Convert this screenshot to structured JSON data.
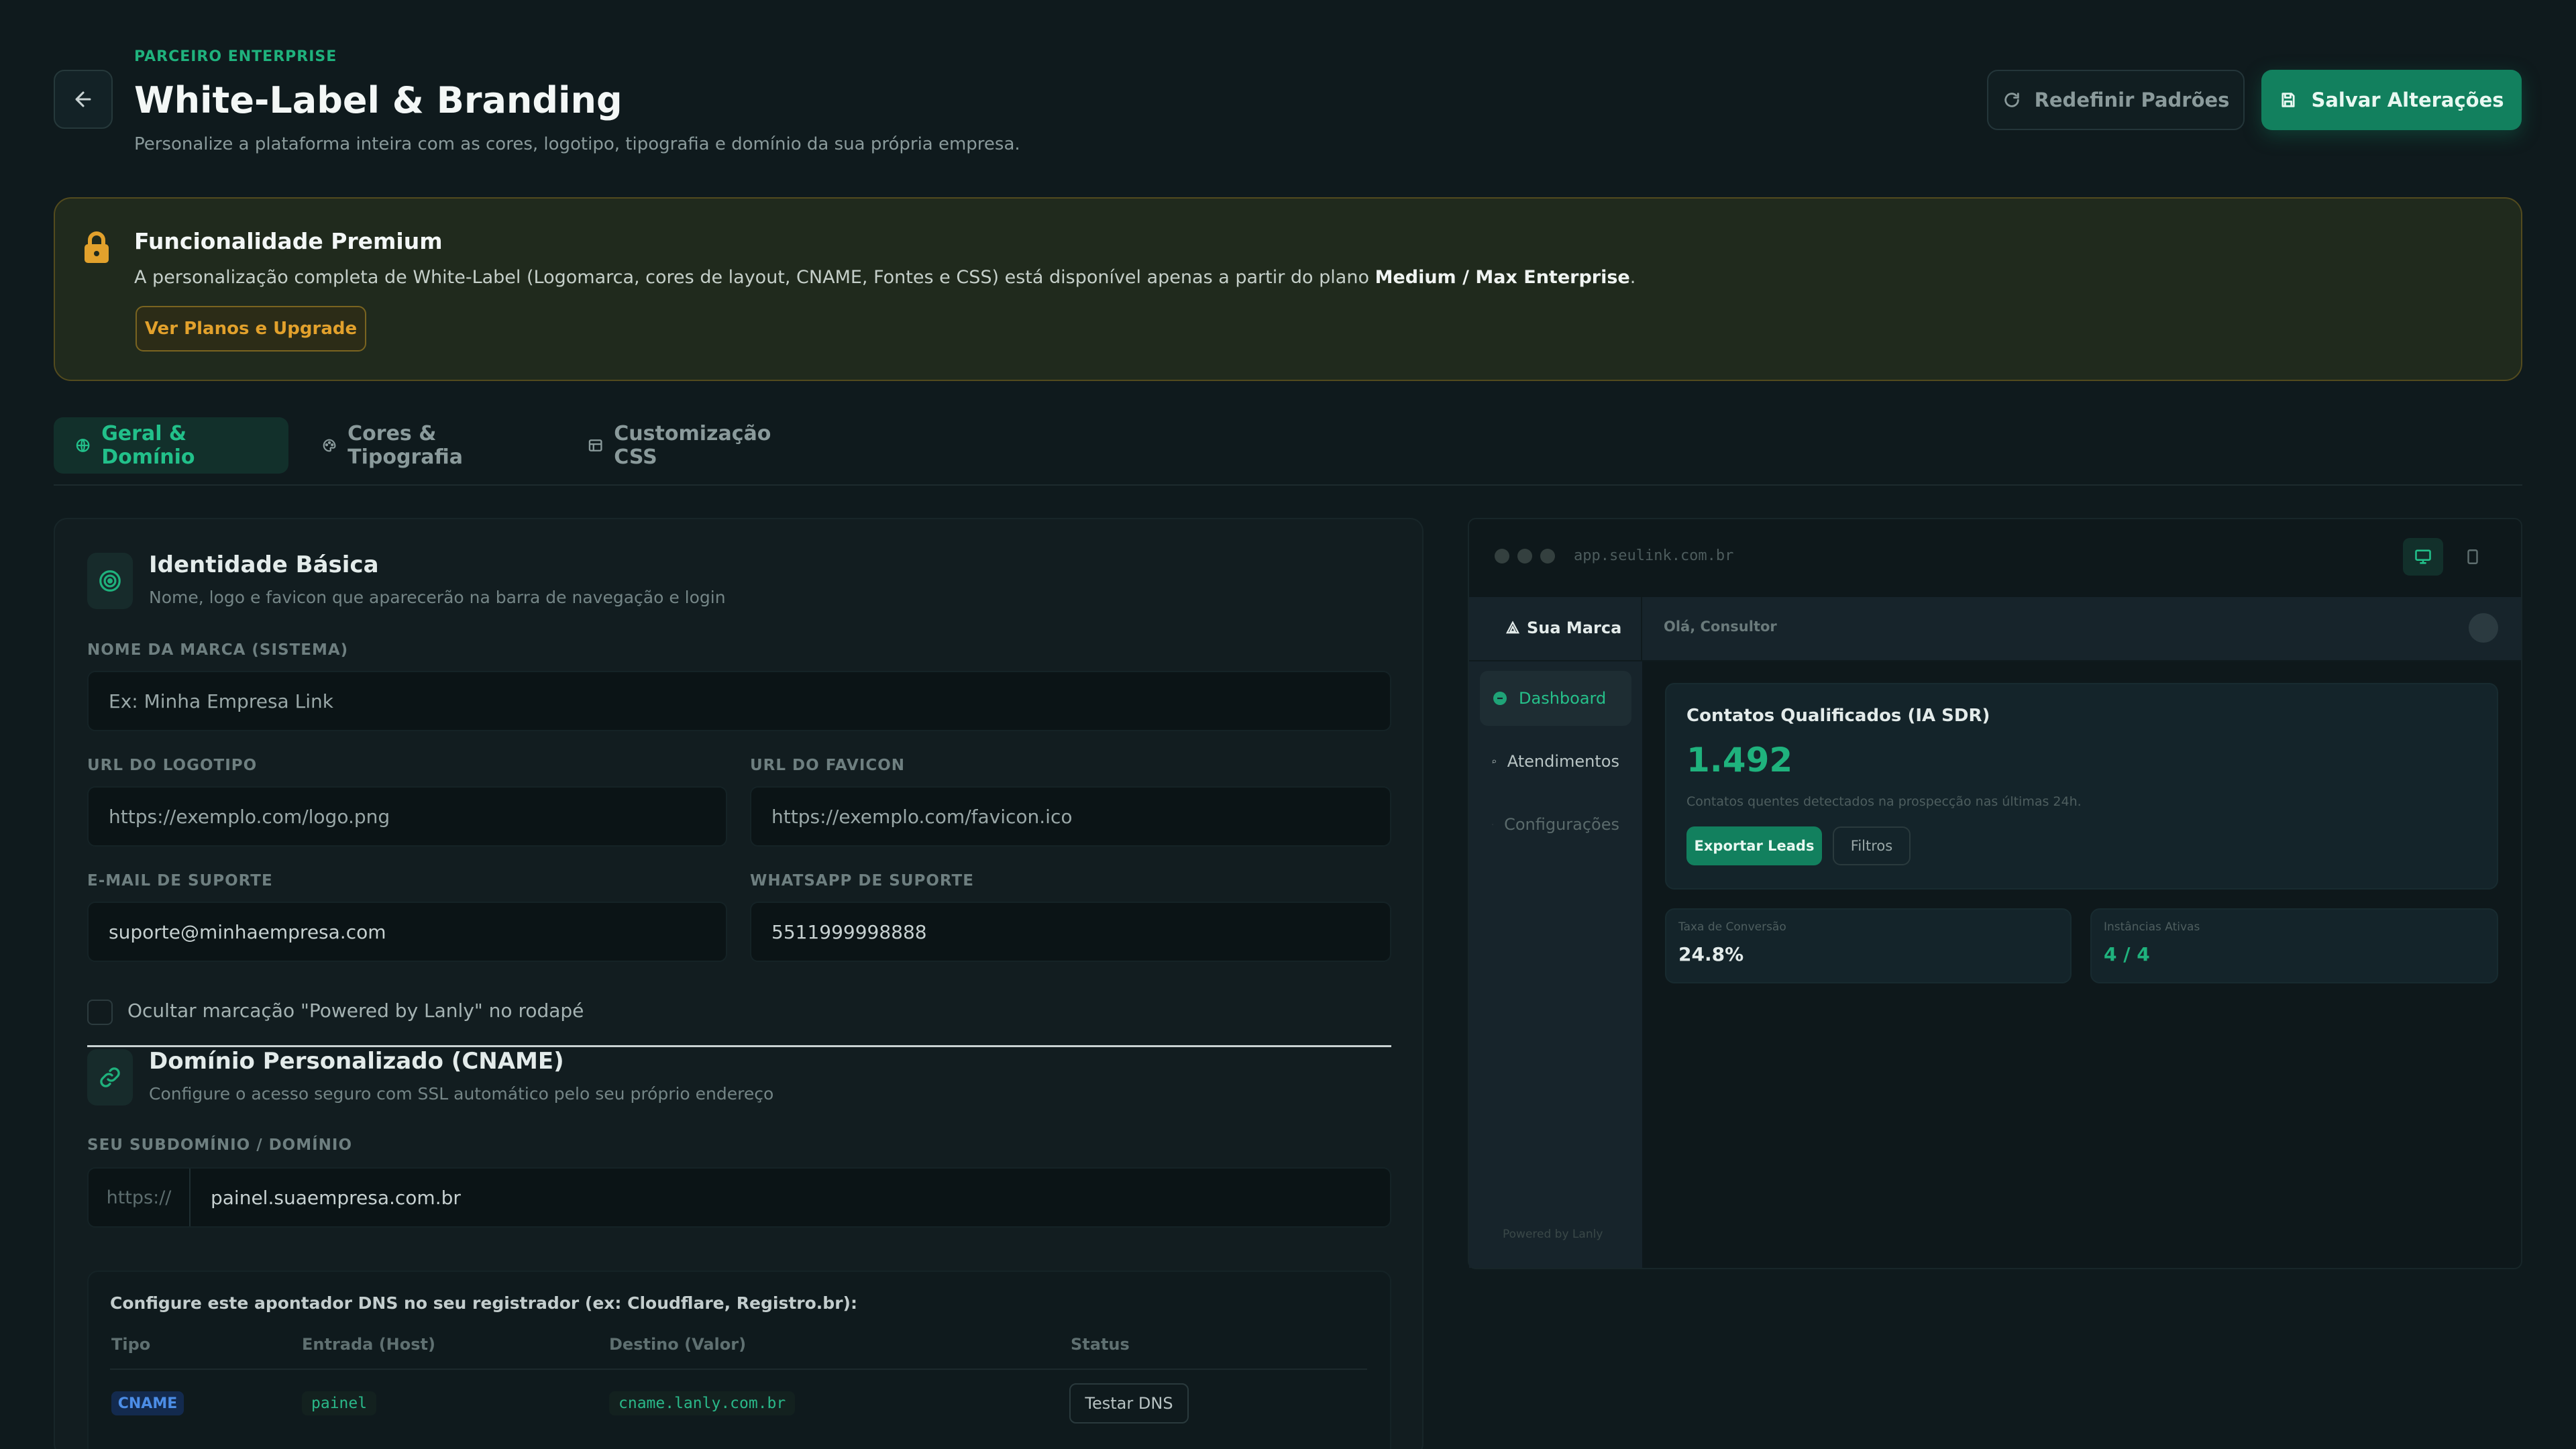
{
  "header": {
    "eyebrow": "PARCEIRO ENTERPRISE",
    "title": "White-Label & Branding",
    "subtitle": "Personalize a plataforma inteira com as cores, logotipo, tipografia e domínio da sua própria empresa.",
    "reset_label": "Redefinir Padrões",
    "save_label": "Salvar Alterações"
  },
  "premium": {
    "title": "Funcionalidade Premium",
    "text": "A personalização completa de White-Label (Logomarca, cores de layout, CNAME, Fontes e CSS) está disponível apenas a partir do plano ",
    "text_bold": "Medium / Max Enterprise",
    "text_end": ".",
    "button": "Ver Planos e Upgrade"
  },
  "tabs": [
    {
      "label": "Geral & Domínio"
    },
    {
      "label": "Cores & Tipografia"
    },
    {
      "label": "Customização CSS"
    }
  ],
  "identity": {
    "title": "Identidade Básica",
    "subtitle": "Nome, logo e favicon que aparecerão na barra de navegação e login",
    "brand_label": "NOME DA MARCA (SISTEMA)",
    "brand_placeholder": "Ex: Minha Empresa Link",
    "logo_label": "URL DO LOGOTIPO",
    "logo_placeholder": "https://exemplo.com/logo.png",
    "favicon_label": "URL DO FAVICON",
    "favicon_placeholder": "https://exemplo.com/favicon.ico",
    "email_label": "E-MAIL DE SUPORTE",
    "email_value": "suporte@minhaempresa.com",
    "whatsapp_label": "WHATSAPP DE SUPORTE",
    "whatsapp_value": "5511999998888",
    "hide_powered_label": "Ocultar marcação \"Powered by Lanly\" no rodapé"
  },
  "domain": {
    "title": "Domínio Personalizado (CNAME)",
    "subtitle": "Configure o acesso seguro com SSL automático pelo seu próprio endereço",
    "field_label": "SEU SUBDOMÍNIO / DOMÍNIO",
    "prefix": "https://",
    "value": "painel.suaempresa.com.br",
    "dns_title": "Configure este apontador DNS no seu registrador (ex: Cloudflare, Registro.br):",
    "columns": [
      "Tipo",
      "Entrada (Host)",
      "Destino (Valor)",
      "Status"
    ],
    "row": {
      "type": "CNAME",
      "host": "painel",
      "target": "cname.lanly.com.br",
      "action": "Testar DNS"
    }
  },
  "preview": {
    "url": "app.seulink.com.br",
    "brand": "Sua Marca",
    "greeting": "Olá, Consultor",
    "nav": [
      "Dashboard",
      "Atendimentos",
      "Configurações"
    ],
    "footer": "Powered by Lanly",
    "card_title": "Contatos Qualificados (IA SDR)",
    "card_value": "1.492",
    "card_desc": "Contatos quentes detectados na prospecção nas últimas 24h.",
    "export_label": "Exportar Leads",
    "filter_label": "Filtros",
    "stat1_label": "Taxa de Conversão",
    "stat1_value": "24.8%",
    "stat2_label": "Instâncias Ativas",
    "stat2_value": "4 / 4"
  },
  "colors": {
    "accent": "#12805e",
    "accent_text": "#22c08a",
    "warning": "#e2a12c",
    "background": "#0f1a1d"
  }
}
